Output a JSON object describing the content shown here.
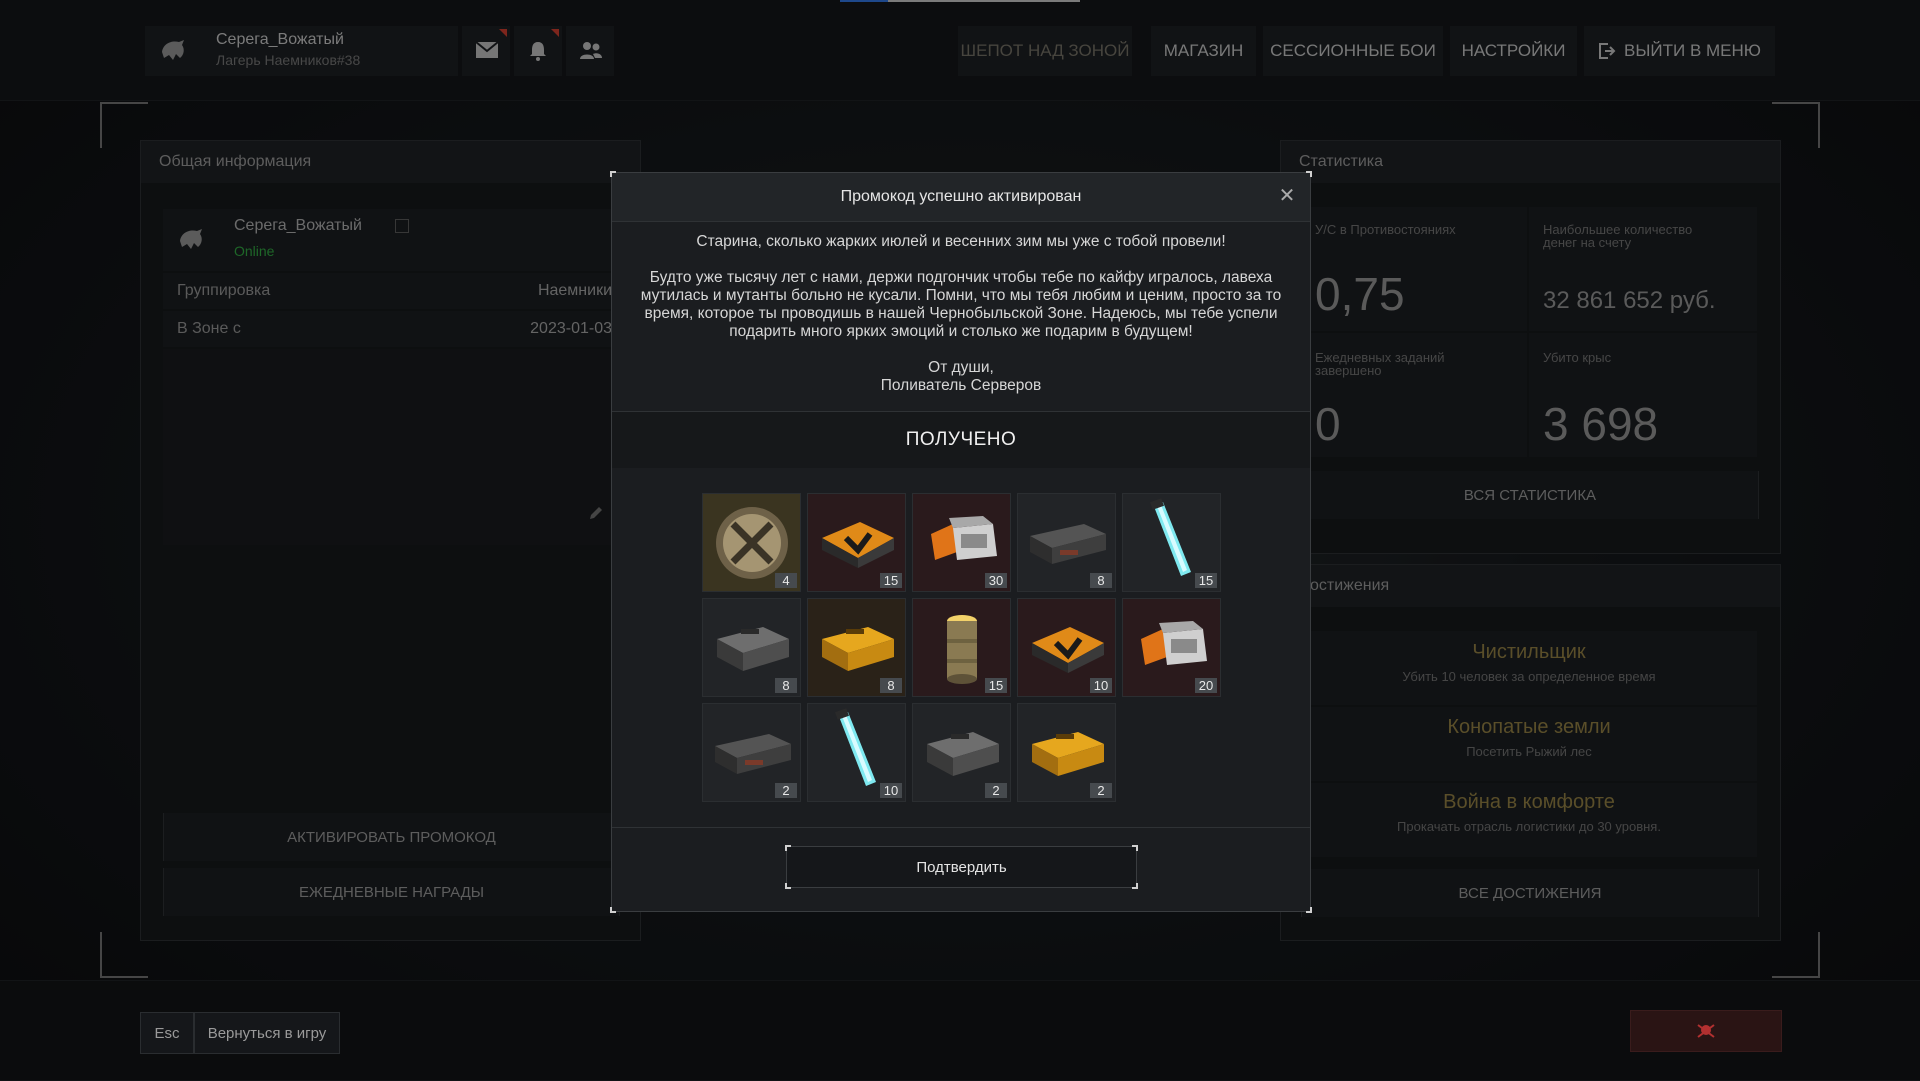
{
  "profile": {
    "name": "Серега_Вожатый",
    "subtitle": "Лагерь Наемников#38"
  },
  "nav": [
    {
      "label": "ШЕПОТ НАД ЗОНОЙ",
      "active": true
    },
    {
      "label": "МАГАЗИН"
    },
    {
      "label": "СЕССИОННЫЕ БОИ"
    },
    {
      "label": "НАСТРОЙКИ"
    },
    {
      "label": "ВЫЙТИ В МЕНЮ",
      "icon": "logout-icon"
    }
  ],
  "general": {
    "title": "Общая информация",
    "name": "Серега_Вожатый",
    "status": "Online",
    "faction_label": "Группировка",
    "faction_value": "Наемники",
    "since_label": "В Зоне с",
    "since_value": "2023-01-03",
    "activate_promo": "АКТИВИРОВАТЬ ПРОМОКОД",
    "daily_rewards": "ЕЖЕДНЕВНЫЕ НАГРАДЫ"
  },
  "stats": {
    "title": "Статистика",
    "kd_label": "У/С в Противостояниях",
    "kd_value": "0,75",
    "money_label": "Наибольшее количество денег на счету",
    "money_value": "32 861 652 руб.",
    "daily_label": "Ежедневных заданий завершено",
    "daily_value": "0",
    "rats_label": "Убито крыс",
    "rats_value": "3 698",
    "all_stats": "ВСЯ СТАТИСТИКА"
  },
  "achievements": {
    "title": "Достижения",
    "items": [
      {
        "title": "Чистильщик",
        "desc": "Убить 10 человек за определенное время"
      },
      {
        "title": "Конопатые земли",
        "desc": "Посетить Рыжий лес"
      },
      {
        "title": "Война в комфорте",
        "desc": "Прокачать отрасль логистики до 30 уровня."
      }
    ],
    "all_achievements": "ВСЕ ДОСТИЖЕНИЯ"
  },
  "modal": {
    "title": "Промокод успешно активирован",
    "message_line1": "Старина, сколько жарких июлей и весенних зим мы уже с тобой провели!",
    "message_body": "Будто уже тысячу лет с нами, держи подгончик чтобы тебе по кайфу игралось, лавеха мутилась и мутанты больно не кусали. Помни, что мы тебя любим и ценим, просто за то время, которое ты проводишь в нашей Чернобыльской Зоне. Надеюсь, мы тебе успели подарить много ярких эмоций и столько же подарим в будущем!",
    "sign1": "От души,",
    "sign2": "Поливатель Серверов",
    "received": "ПОЛУЧЕНО",
    "confirm": "Подтвердить",
    "items": [
      {
        "icon": "tools-badge-icon",
        "count": "4",
        "tint": "#3a3420"
      },
      {
        "icon": "hazard-case-icon",
        "count": "15",
        "tint": "#2a1a1c"
      },
      {
        "icon": "orange-crate-icon",
        "count": "30",
        "tint": "#2a1a1c"
      },
      {
        "icon": "ammo-box-icon",
        "count": "8",
        "tint": "#222427"
      },
      {
        "icon": "glowstick-icon",
        "count": "15",
        "tint": "#222427"
      },
      {
        "icon": "grey-case-icon",
        "count": "8",
        "tint": "#222427"
      },
      {
        "icon": "gold-case-icon",
        "count": "8",
        "tint": "#2a2218"
      },
      {
        "icon": "canister-icon",
        "count": "15",
        "tint": "#2a1a1c"
      },
      {
        "icon": "hazard-case-icon",
        "count": "10",
        "tint": "#2a1a1c"
      },
      {
        "icon": "orange-crate-icon",
        "count": "20",
        "tint": "#2a1a1c"
      },
      {
        "icon": "ammo-box-icon",
        "count": "2",
        "tint": "#222427"
      },
      {
        "icon": "glowstick-icon",
        "count": "10",
        "tint": "#222427"
      },
      {
        "icon": "grey-case-icon",
        "count": "2",
        "tint": "#222427"
      },
      {
        "icon": "gold-case-icon",
        "count": "2",
        "tint": "#222427"
      }
    ]
  },
  "bottom": {
    "esc": "Esc",
    "back": "Вернуться в игру"
  },
  "colors": {
    "accent_green": "#2e9e3e",
    "achievement_gold": "#8a7940",
    "alert_red": "#c0392b"
  }
}
